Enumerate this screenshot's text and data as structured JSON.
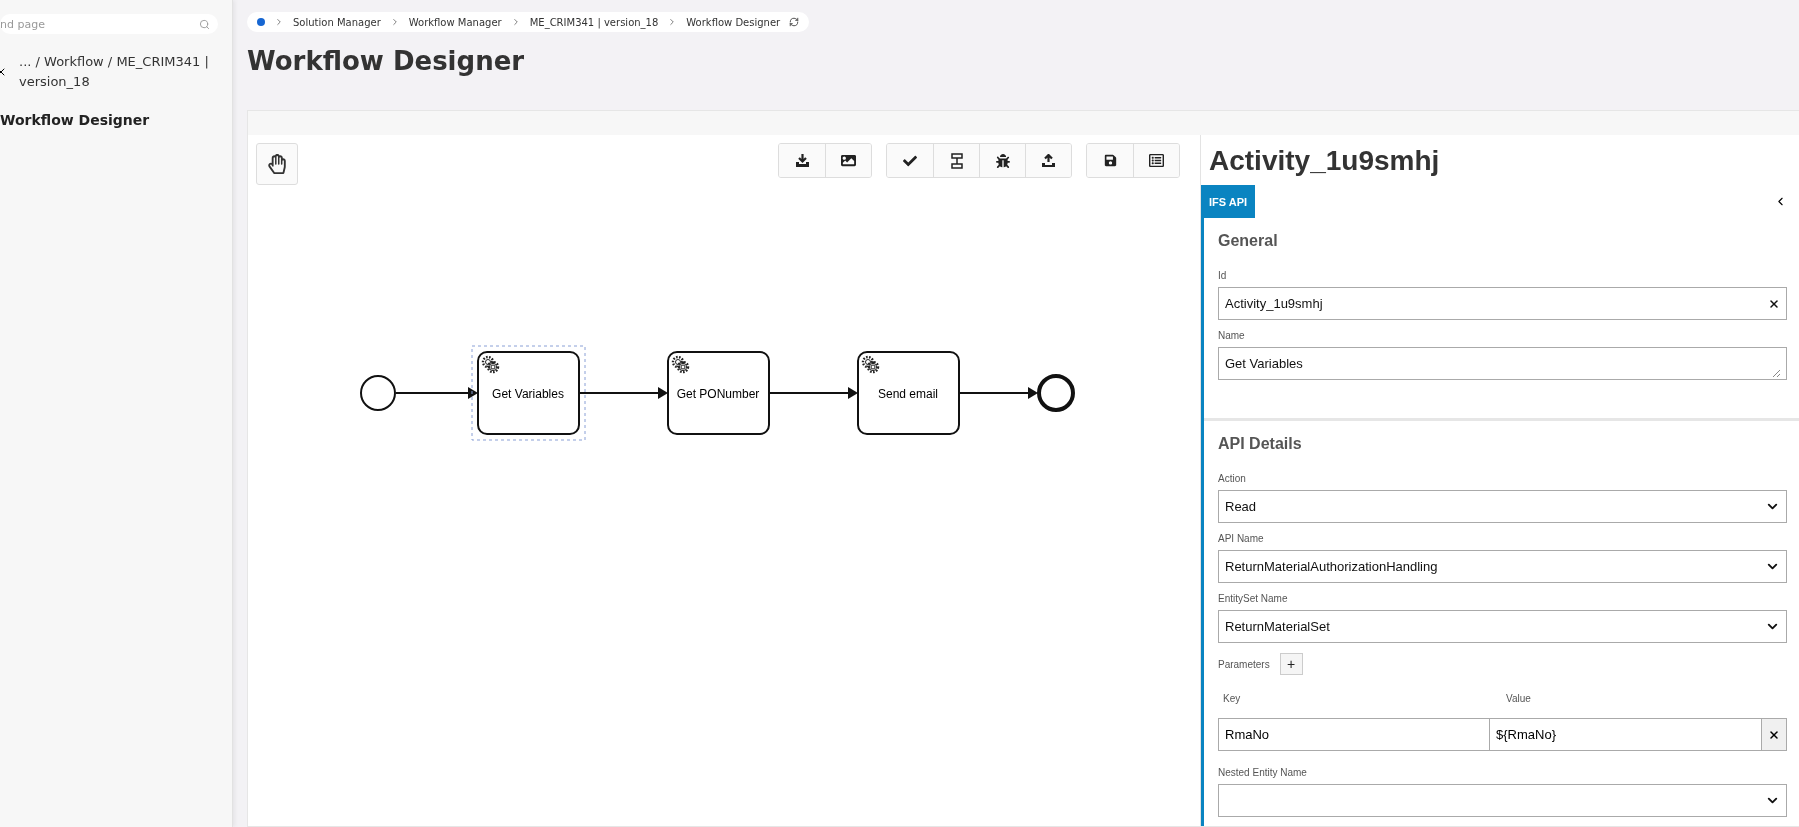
{
  "sidebar": {
    "search": {
      "placeholder": "nd page"
    },
    "path": "... / Workflow / ME_CRIM341 | version_18",
    "current_page": "Workflow Designer"
  },
  "breadcrumb": [
    "Solution Manager",
    "Workflow Manager",
    "ME_CRIM341 | version_18",
    "Workflow Designer"
  ],
  "page_title": "Workflow Designer",
  "diagram": {
    "tasks": [
      {
        "label": "Get Variables",
        "selected": true
      },
      {
        "label": "Get PONumber",
        "selected": false
      },
      {
        "label": "Send email",
        "selected": false
      }
    ]
  },
  "properties": {
    "title": "Activity_1u9smhj",
    "tabs": [
      {
        "label": "IFS API",
        "selected": true
      }
    ],
    "sections": [
      {
        "title": "General",
        "fields": [
          {
            "kind": "input",
            "label": "Id",
            "value": "Activity_1u9smhj"
          },
          {
            "kind": "textarea",
            "label": "Name",
            "value": "Get Variables"
          }
        ]
      },
      {
        "title": "API Details",
        "fields": [
          {
            "kind": "select",
            "label": "Action",
            "value": "Read"
          },
          {
            "kind": "select",
            "label": "API Name",
            "value": "ReturnMaterialAuthorizationHandling"
          },
          {
            "kind": "select",
            "label": "EntitySet Name",
            "value": "ReturnMaterialSet"
          },
          {
            "kind": "parameters",
            "label": "Parameters",
            "add": "+",
            "key_label": "Key",
            "value_label": "Value",
            "rows": [
              {
                "key": "RmaNo",
                "value": "${RmaNo}"
              }
            ]
          },
          {
            "kind": "select",
            "label": "Nested Entity Name"
          }
        ]
      }
    ]
  }
}
